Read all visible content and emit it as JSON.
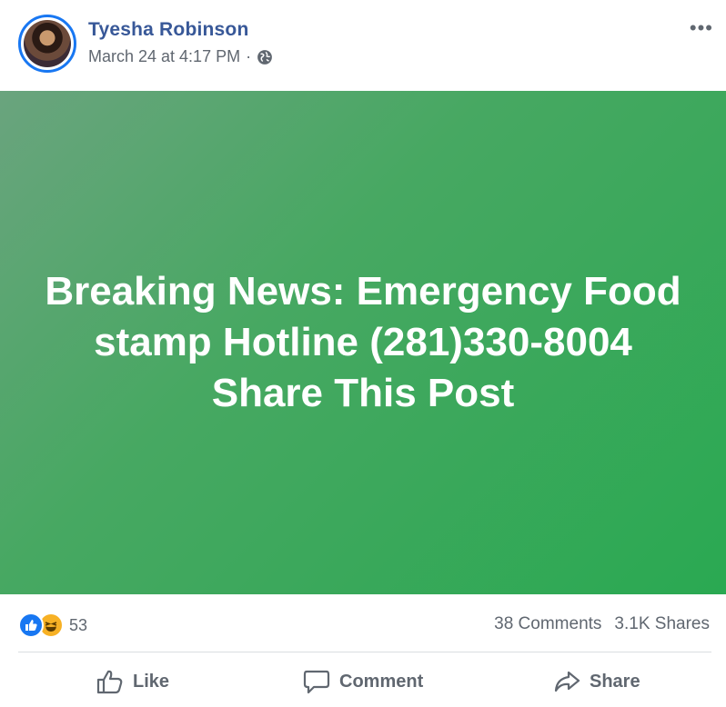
{
  "post": {
    "author": "Tyesha Robinson",
    "timestamp": "March 24 at 4:17 PM",
    "separator": "·",
    "privacy_icon": "globe-icon",
    "more_label": "•••",
    "banner_text": "Breaking News: Emergency Food stamp Hotline (281)330-8004 Share This Post",
    "banner_colors": [
      "#6aa47e",
      "#2aa952"
    ]
  },
  "stats": {
    "reaction_icons": [
      "like-icon",
      "haha-icon"
    ],
    "reaction_count": "53",
    "comments": "38 Comments",
    "shares": "3.1K Shares"
  },
  "actions": {
    "like": "Like",
    "comment": "Comment",
    "share": "Share"
  },
  "colors": {
    "name": "#385898",
    "secondary_text": "#606770",
    "like_blue": "#1877f2",
    "haha_yellow": "#f7b125"
  }
}
